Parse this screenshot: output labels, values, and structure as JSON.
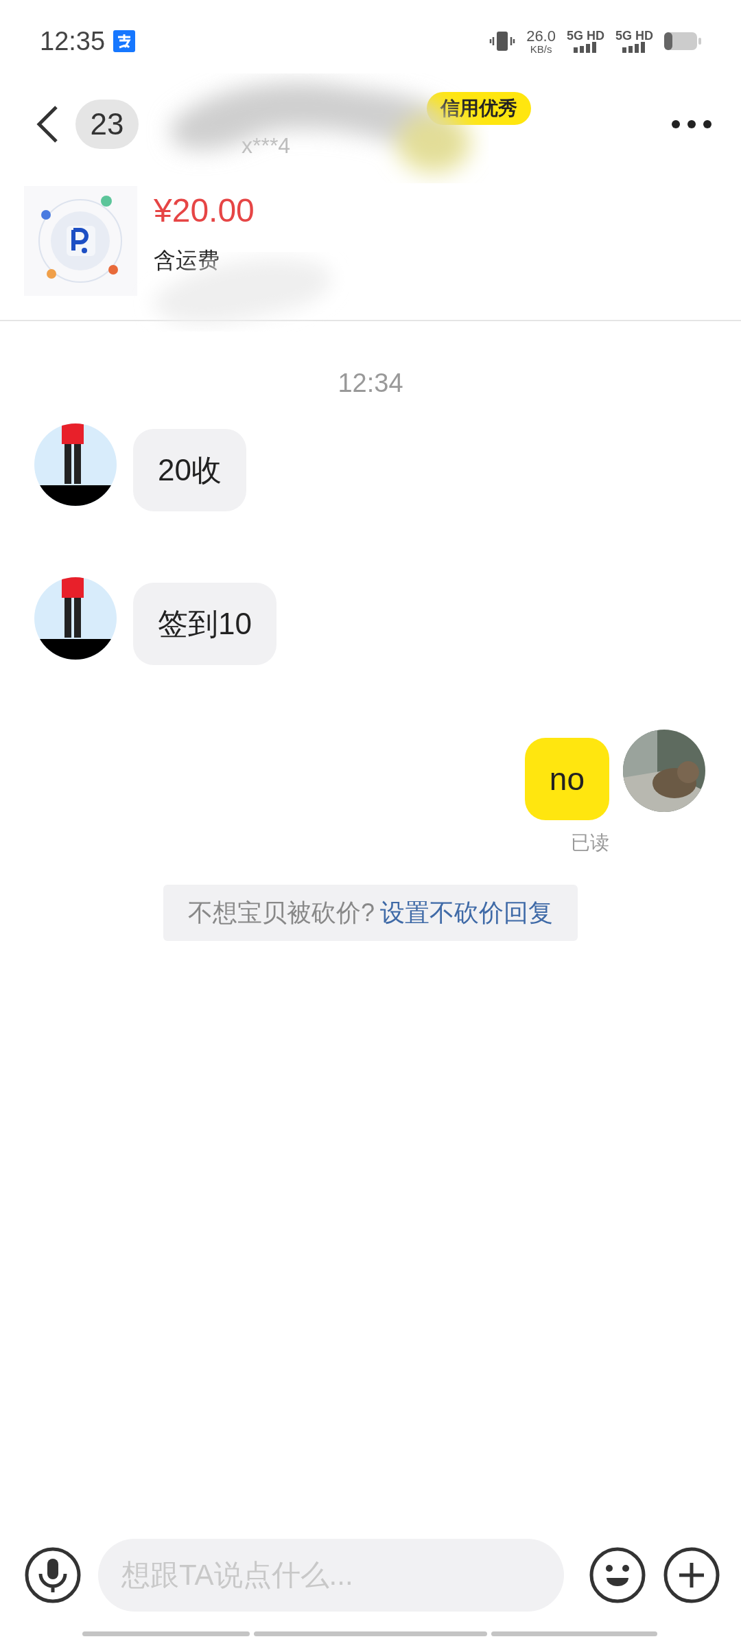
{
  "status_bar": {
    "time": "12:35",
    "net_speed": "26.0",
    "net_unit": "KB/s",
    "sim1": "5G HD",
    "sim2": "5G HD"
  },
  "header": {
    "back_count": "23",
    "account": "x***4",
    "credit_badge": "信用优秀"
  },
  "product": {
    "price": "¥20.00",
    "shipping": "含运费"
  },
  "chat": {
    "timestamp": "12:34",
    "messages": [
      {
        "kind": "incoming",
        "text": "20收"
      },
      {
        "kind": "incoming",
        "text": "签到10"
      },
      {
        "kind": "outgoing",
        "text": "no",
        "receipt": "已读"
      }
    ]
  },
  "notice": {
    "text": "不想宝贝被砍价?",
    "link": "设置不砍价回复"
  },
  "composer": {
    "placeholder": "想跟TA说点什么..."
  }
}
